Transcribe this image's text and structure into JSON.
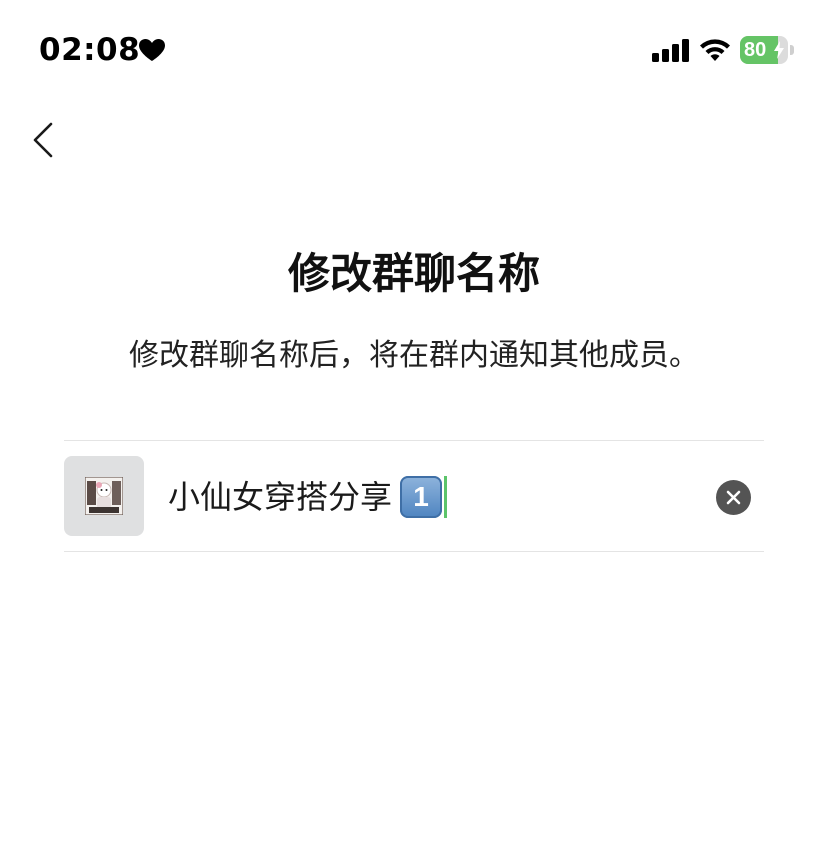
{
  "status_bar": {
    "time": "02:08",
    "battery_level": "80",
    "battery_fraction": 0.8,
    "battery_color": "#65c466",
    "icons": [
      "heart-icon",
      "signal-icon",
      "wifi-icon",
      "battery-icon",
      "charging-bolt-icon"
    ]
  },
  "nav": {
    "back_icon": "chevron-left-icon"
  },
  "header": {
    "title": "修改群聊名称",
    "subtitle": "修改群聊名称后，将在群内通知其他成员。"
  },
  "name_field": {
    "value": "小仙女穿搭分享",
    "emoji_keycap": "1",
    "cursor_color": "#5cc46a",
    "clear_icon": "clear-x-icon"
  },
  "colors": {
    "divider": "#e4e4e4",
    "avatar_bg": "#dfe0e1",
    "clear_button_bg": "#545454"
  }
}
